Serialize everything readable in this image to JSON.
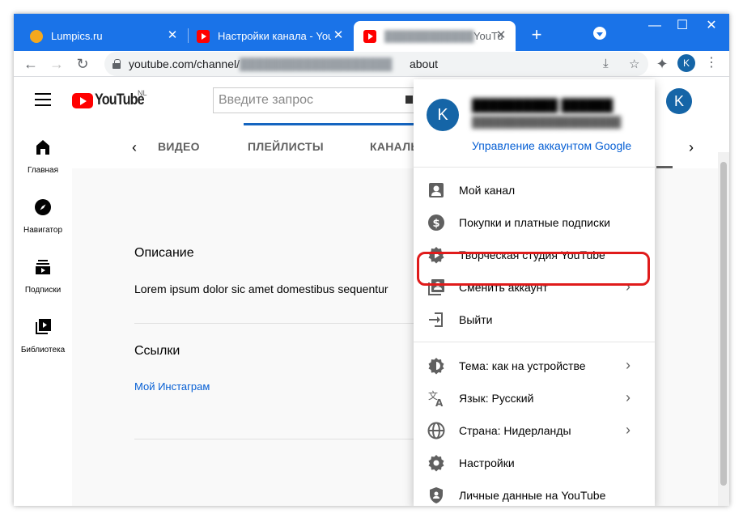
{
  "browser": {
    "tabs": [
      {
        "title": "Lumpics.ru",
        "close": "✕"
      },
      {
        "title": "Настройки канала - YouTu",
        "close": "✕"
      },
      {
        "title": "YouTu",
        "close": "✕"
      }
    ],
    "new_tab": "+",
    "window_controls": {
      "minimize": "—",
      "maximize": "☐",
      "close": "✕"
    },
    "url_prefix": "youtube.com/channel/",
    "url_suffix": "about",
    "profile_letter": "K",
    "accent_color": "#1a73e8"
  },
  "youtube": {
    "logo_text": "YouTube",
    "logo_region": "NL",
    "search_placeholder": "Введите запрос",
    "header_avatar": "K",
    "nav": [
      {
        "label": "Главная",
        "icon": "home-icon"
      },
      {
        "label": "Навигатор",
        "icon": "compass-icon"
      },
      {
        "label": "Подписки",
        "icon": "subscriptions-icon"
      },
      {
        "label": "Библиотека",
        "icon": "library-icon"
      }
    ],
    "channel_tabs": [
      "ВИДЕО",
      "ПЛЕЙЛИСТЫ",
      "КАНАЛЫ"
    ],
    "about": {
      "description_title": "Описание",
      "description_text": "Lorem ipsum dolor sic amet domestibus sequentur",
      "links_title": "Ссылки",
      "link_label": "Мой Инстаграм"
    }
  },
  "account_menu": {
    "avatar_letter": "K",
    "manage_account": "Управление аккаунтом Google",
    "items_group1": [
      {
        "label": "Мой канал",
        "icon": "account-box-icon",
        "chevron": false
      },
      {
        "label": "Покупки и платные подписки",
        "icon": "dollar-icon",
        "chevron": false
      },
      {
        "label": "Творческая студия YouTube",
        "icon": "studio-gear-icon",
        "chevron": false
      },
      {
        "label": "Сменить аккаунт",
        "icon": "switch-account-icon",
        "chevron": true
      },
      {
        "label": "Выйти",
        "icon": "sign-out-icon",
        "chevron": false
      }
    ],
    "items_group2": [
      {
        "label": "Тема: как на устройстве",
        "icon": "theme-icon",
        "chevron": true
      },
      {
        "label": "Язык: Русский",
        "icon": "translate-icon",
        "chevron": true
      },
      {
        "label": "Страна: Нидерланды",
        "icon": "globe-icon",
        "chevron": true
      },
      {
        "label": "Настройки",
        "icon": "settings-icon",
        "chevron": false
      },
      {
        "label": "Личные данные на YouTube",
        "icon": "privacy-shield-icon",
        "chevron": false
      }
    ],
    "highlight_color": "#e01b1b"
  }
}
